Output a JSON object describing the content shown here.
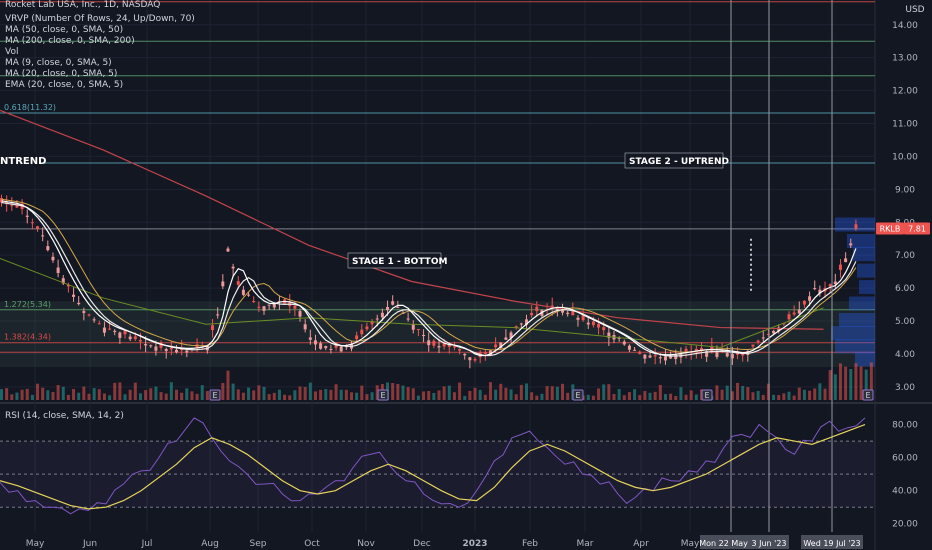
{
  "header": {
    "title": "Rocket Lab USA, Inc., 1D, NASDAQ",
    "indicators": [
      "VRVP (Number Of Rows, 24, Up/Down, 70)",
      "MA (50, close, 0, SMA, 50)",
      "MA (200, close, 0, SMA, 200)",
      "Vol",
      "MA (9, close, 0, SMA, 5)",
      "MA (20, close, 0, SMA, 5)",
      "EMA (20, close, 0, SMA, 5)"
    ]
  },
  "currency": "USD",
  "ticker_badge": "RKLB",
  "price_badge": "7.81",
  "rsi_label": "RSI (14, close, SMA, 14, 2)",
  "annotations": {
    "stage1": "STAGE 1 - BOTTOM",
    "stage2": "STAGE 2 - UPTREND",
    "left": "NTREND"
  },
  "fib_labels": {
    "f0618": "0.618(11.32)",
    "f1272": "1.272(5.34)",
    "f1382": "1.382(4.34)"
  },
  "crosshair_labels": [
    "Mon 22 May '23",
    "3 Jun '23",
    "Wed 19 Jul '23"
  ],
  "colors": {
    "background": "#131722",
    "grid": "#1e2333",
    "up": "#ef5350",
    "down": "#ef5350",
    "ma9": "#ffffff",
    "ma20": "#e8e8e8",
    "ema20": "#d4a74a",
    "ma50": "#6b8e23",
    "ma200": "#c2444a",
    "rsi": "#7e57c2",
    "rsi_ma": "#e6d35b",
    "fib_green": "#5da06d",
    "fib_red": "#d84b4b",
    "fib_blue": "#5aa7b8"
  },
  "chart_data": [
    {
      "type": "candlestick",
      "title": "Rocket Lab USA, Inc., 1D, NASDAQ",
      "ylabel": "USD",
      "y_ticks": [
        "3.00",
        "4.00",
        "5.00",
        "6.00",
        "7.00",
        "8.00",
        "9.00",
        "10.00",
        "11.00",
        "12.00",
        "13.00",
        "14.00"
      ],
      "x_ticks": [
        "May",
        "Jun",
        "Jul",
        "Aug",
        "Sep",
        "Oct",
        "Nov",
        "Dec",
        "2023",
        "Feb",
        "Mar",
        "Apr",
        "May"
      ],
      "ylim": [
        2.6,
        14.6
      ],
      "fib_levels": [
        {
          "label": "0.618(11.32)",
          "value": 11.32,
          "color": "#5aa7b8"
        },
        {
          "label": "1.272(5.34)",
          "value": 5.34,
          "color": "#5da06d"
        },
        {
          "label": "1.382(4.34)",
          "value": 4.34,
          "color": "#d84b4b"
        },
        {
          "label": "",
          "value": 14.7,
          "color": "#d84b4b"
        },
        {
          "label": "",
          "value": 13.5,
          "color": "#5da06d"
        },
        {
          "label": "",
          "value": 12.45,
          "color": "#5da06d"
        },
        {
          "label": "",
          "value": 9.8,
          "color": "#5aa7b8"
        },
        {
          "label": "",
          "value": 7.8,
          "color": "#9598a1"
        },
        {
          "label": "",
          "value": 4.05,
          "color": "#d84b4b"
        }
      ],
      "price_path": [
        [
          0,
          8.6
        ],
        [
          4,
          8.4
        ],
        [
          8,
          7.6
        ],
        [
          12,
          6.3
        ],
        [
          16,
          5.3
        ],
        [
          20,
          4.8
        ],
        [
          24,
          4.6
        ],
        [
          28,
          4.3
        ],
        [
          32,
          4.15
        ],
        [
          36,
          4.1
        ],
        [
          40,
          4.25
        ],
        [
          42,
          5.2
        ],
        [
          44,
          7.2
        ],
        [
          46,
          6.1
        ],
        [
          48,
          5.8
        ],
        [
          50,
          5.4
        ],
        [
          54,
          5.6
        ],
        [
          58,
          5.3
        ],
        [
          60,
          4.5
        ],
        [
          64,
          4.15
        ],
        [
          68,
          4.3
        ],
        [
          72,
          4.9
        ],
        [
          76,
          5.6
        ],
        [
          80,
          4.9
        ],
        [
          84,
          4.25
        ],
        [
          88,
          4.2
        ],
        [
          92,
          3.8
        ],
        [
          96,
          4.2
        ],
        [
          100,
          4.8
        ],
        [
          104,
          5.3
        ],
        [
          108,
          5.4
        ],
        [
          112,
          5.1
        ],
        [
          116,
          4.8
        ],
        [
          120,
          4.5
        ],
        [
          124,
          4.0
        ],
        [
          128,
          3.9
        ],
        [
          132,
          4.0
        ],
        [
          136,
          4.1
        ],
        [
          140,
          4.05
        ],
        [
          144,
          3.95
        ],
        [
          148,
          4.5
        ],
        [
          152,
          4.9
        ],
        [
          156,
          5.5
        ],
        [
          158,
          6.0
        ],
        [
          160,
          5.9
        ],
        [
          162,
          6.2
        ],
        [
          164,
          6.9
        ],
        [
          166,
          7.81
        ]
      ],
      "ma200_path": [
        [
          0,
          11.4
        ],
        [
          20,
          10.2
        ],
        [
          40,
          8.8
        ],
        [
          60,
          7.3
        ],
        [
          80,
          6.2
        ],
        [
          100,
          5.6
        ],
        [
          120,
          5.1
        ],
        [
          140,
          4.8
        ],
        [
          160,
          4.75
        ]
      ],
      "ma50_path": [
        [
          0,
          6.9
        ],
        [
          20,
          5.7
        ],
        [
          40,
          4.9
        ],
        [
          60,
          5.1
        ],
        [
          80,
          4.9
        ],
        [
          100,
          4.8
        ],
        [
          120,
          4.5
        ],
        [
          140,
          4.2
        ],
        [
          160,
          5.4
        ]
      ],
      "volume_note": "daily volume bars"
    },
    {
      "type": "line",
      "title": "RSI (14, close, SMA, 14, 2)",
      "y_ticks": [
        "20.00",
        "40.00",
        "60.00",
        "80.00"
      ],
      "ylim": [
        15,
        90
      ],
      "bands": [
        30,
        50,
        70
      ],
      "series": [
        {
          "name": "RSI",
          "values": [
            45,
            40,
            34,
            30,
            26,
            28,
            32,
            44,
            52,
            60,
            70,
            84,
            72,
            58,
            50,
            44,
            38,
            34,
            38,
            46,
            54,
            62,
            56,
            46,
            38,
            32,
            30,
            40,
            58,
            72,
            76,
            66,
            56,
            50,
            44,
            38,
            36,
            40,
            46,
            52,
            58,
            66,
            74,
            80,
            72,
            62,
            70,
            82,
            78,
            84
          ]
        },
        {
          "name": "RSI MA",
          "values": [
            46,
            43,
            39,
            35,
            31,
            29,
            30,
            34,
            40,
            48,
            56,
            66,
            72,
            68,
            62,
            54,
            46,
            40,
            38,
            40,
            46,
            52,
            56,
            52,
            46,
            40,
            35,
            34,
            42,
            54,
            64,
            68,
            64,
            58,
            52,
            46,
            42,
            40,
            42,
            46,
            50,
            56,
            62,
            68,
            72,
            70,
            68,
            72,
            76,
            80
          ]
        }
      ]
    }
  ]
}
